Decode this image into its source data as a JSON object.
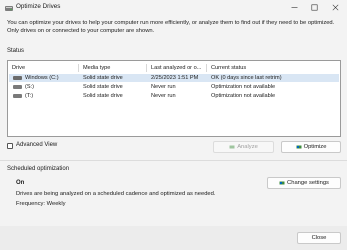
{
  "window": {
    "title": "Optimize Drives"
  },
  "intro_text": "You can optimize your drives to help your computer run more efficiently, or analyze them to find out if they need to be optimized. Only drives on or connected to your computer are shown.",
  "status": {
    "label": "Status",
    "columns": [
      "Drive",
      "Media type",
      "Last analyzed or o...",
      "Current status"
    ],
    "rows": [
      {
        "drive": "Windows (C:)",
        "media": "Solid state drive",
        "last": "2/25/2023 1:51 PM",
        "status": "OK (0 days since last retrim)",
        "selected": true
      },
      {
        "drive": "(S:)",
        "media": "Solid state drive",
        "last": "Never run",
        "status": "Optimization not available",
        "selected": false
      },
      {
        "drive": "(T:)",
        "media": "Solid state drive",
        "last": "Never run",
        "status": "Optimization not available",
        "selected": false
      }
    ]
  },
  "buttons": {
    "analyze": "Analyze",
    "optimize": "Optimize",
    "change_settings": "Change settings",
    "close": "Close"
  },
  "advanced_view": {
    "label": "Advanced View",
    "checked": false
  },
  "scheduled": {
    "label": "Scheduled optimization",
    "state": "On",
    "description": "Drives are being analyzed on a scheduled cadence and optimized as needed.",
    "frequency": "Frequency: Weekly"
  },
  "colors": {
    "accent": "#0067c0",
    "selected_row": "#d9e6f4",
    "background": "#f3f3f3"
  }
}
